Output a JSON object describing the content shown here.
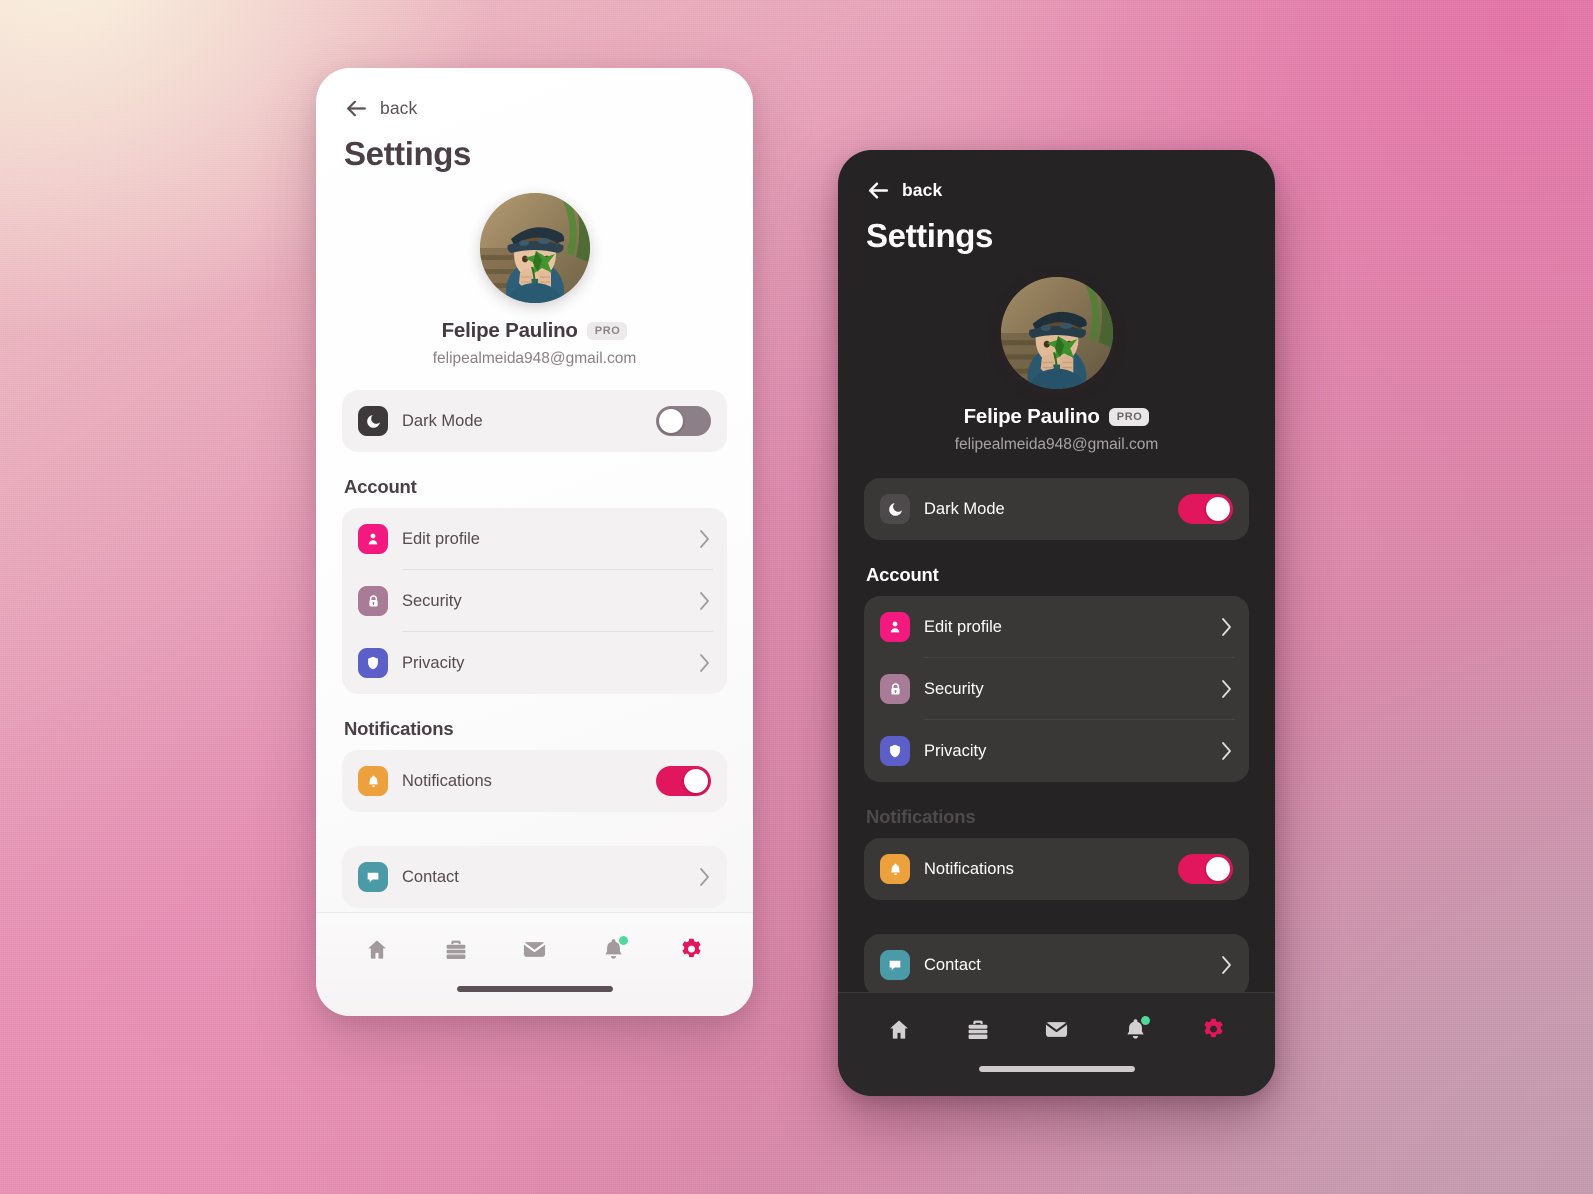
{
  "background": {
    "colors": [
      "#faf2de",
      "#e272a4",
      "#e98fb4",
      "#c398ac"
    ]
  },
  "accent": {
    "crimson": "#e2165c",
    "badge_green": "#4fd99b"
  },
  "phones": [
    {
      "theme": "light",
      "back": {
        "label": "back",
        "icon": "arrow-left-icon"
      },
      "title": "Settings",
      "profile": {
        "name": "Felipe Paulino",
        "badge": "PRO",
        "email": "felipealmeida948@gmail.com",
        "avatar_alt": "child-holding-leaf-photo"
      },
      "darkmode_row": {
        "label": "Dark Mode",
        "icon": "moon-icon",
        "icon_color": "#3e3a3c",
        "toggle_state": "off"
      },
      "sections": [
        {
          "heading": "Account",
          "heading_dim": false,
          "rows": [
            {
              "label": "Edit profile",
              "icon": "person-icon",
              "icon_color": "#f4197f",
              "accessory": "chevron"
            },
            {
              "label": "Security",
              "icon": "lock-icon",
              "icon_color": "#a87b96",
              "accessory": "chevron"
            },
            {
              "label": "Privacity",
              "icon": "shield-icon",
              "icon_color": "#5b5fc7",
              "accessory": "chevron"
            }
          ]
        },
        {
          "heading": "Notifications",
          "heading_dim": false,
          "rows": [
            {
              "label": "Notifications",
              "icon": "bell-icon",
              "icon_color": "#eca13c",
              "accessory": "toggle",
              "toggle_state": "on"
            }
          ]
        }
      ],
      "contact_row": {
        "label": "Contact",
        "icon": "chat-icon",
        "icon_color": "#4a9aa8",
        "accessory": "chevron"
      },
      "nav": [
        {
          "name": "home",
          "icon": "home-icon",
          "active": false,
          "dot": false
        },
        {
          "name": "briefcase",
          "icon": "briefcase-icon",
          "active": false,
          "dot": false
        },
        {
          "name": "mail",
          "icon": "envelope-icon",
          "active": false,
          "dot": false
        },
        {
          "name": "alerts",
          "icon": "bell-icon",
          "active": false,
          "dot": true
        },
        {
          "name": "settings",
          "icon": "gear-icon",
          "active": true,
          "dot": false
        }
      ]
    },
    {
      "theme": "dark",
      "back": {
        "label": "back",
        "icon": "arrow-left-icon"
      },
      "title": "Settings",
      "profile": {
        "name": "Felipe Paulino",
        "badge": "PRO",
        "email": "felipealmeida948@gmail.com",
        "avatar_alt": "child-holding-leaf-photo"
      },
      "darkmode_row": {
        "label": "Dark Mode",
        "icon": "moon-icon",
        "icon_color": "#4e4a4b",
        "toggle_state": "on"
      },
      "sections": [
        {
          "heading": "Account",
          "heading_dim": false,
          "rows": [
            {
              "label": "Edit profile",
              "icon": "person-icon",
              "icon_color": "#f4197f",
              "accessory": "chevron"
            },
            {
              "label": "Security",
              "icon": "lock-icon",
              "icon_color": "#a87b96",
              "accessory": "chevron"
            },
            {
              "label": "Privacity",
              "icon": "shield-icon",
              "icon_color": "#5b5fc7",
              "accessory": "chevron"
            }
          ]
        },
        {
          "heading": "Notifications",
          "heading_dim": true,
          "rows": [
            {
              "label": "Notifications",
              "icon": "bell-icon",
              "icon_color": "#eca13c",
              "accessory": "toggle",
              "toggle_state": "on"
            }
          ]
        }
      ],
      "contact_row": {
        "label": "Contact",
        "icon": "chat-icon",
        "icon_color": "#4a9aa8",
        "accessory": "chevron"
      },
      "nav": [
        {
          "name": "home",
          "icon": "home-icon",
          "active": false,
          "dot": false
        },
        {
          "name": "briefcase",
          "icon": "briefcase-icon",
          "active": false,
          "dot": false
        },
        {
          "name": "mail",
          "icon": "envelope-icon",
          "active": false,
          "dot": false
        },
        {
          "name": "alerts",
          "icon": "bell-icon",
          "active": false,
          "dot": true
        },
        {
          "name": "settings",
          "icon": "gear-icon",
          "active": true,
          "dot": false
        }
      ]
    }
  ]
}
